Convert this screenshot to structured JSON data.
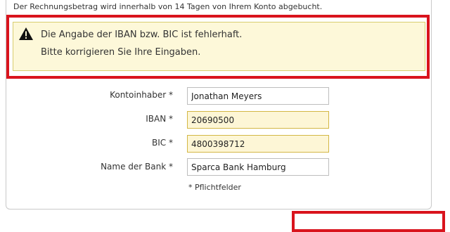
{
  "intro_text": "Der Rechnungsbetrag wird innerhalb von 14 Tagen von Ihrem Konto abgebucht.",
  "error": {
    "icon": "warning-triangle-icon",
    "line1": "Die Angabe der IBAN bzw. BIC ist fehlerhaft.",
    "line2": "Bitte korrigieren Sie Ihre Eingaben.",
    "highlight_color": "#d9141d",
    "background_color": "#fdf8d9"
  },
  "form": {
    "fields": [
      {
        "label": "Kontoinhaber *",
        "value": "Jonathan Meyers",
        "state": "normal"
      },
      {
        "label": "IBAN *",
        "value": "20690500",
        "state": "error"
      },
      {
        "label": "BIC *",
        "value": "4800398712",
        "state": "error"
      },
      {
        "label": "Name der Bank *",
        "value": "Sparca Bank Hamburg",
        "state": "normal"
      }
    ],
    "required_note": "* Pflichtfelder"
  }
}
